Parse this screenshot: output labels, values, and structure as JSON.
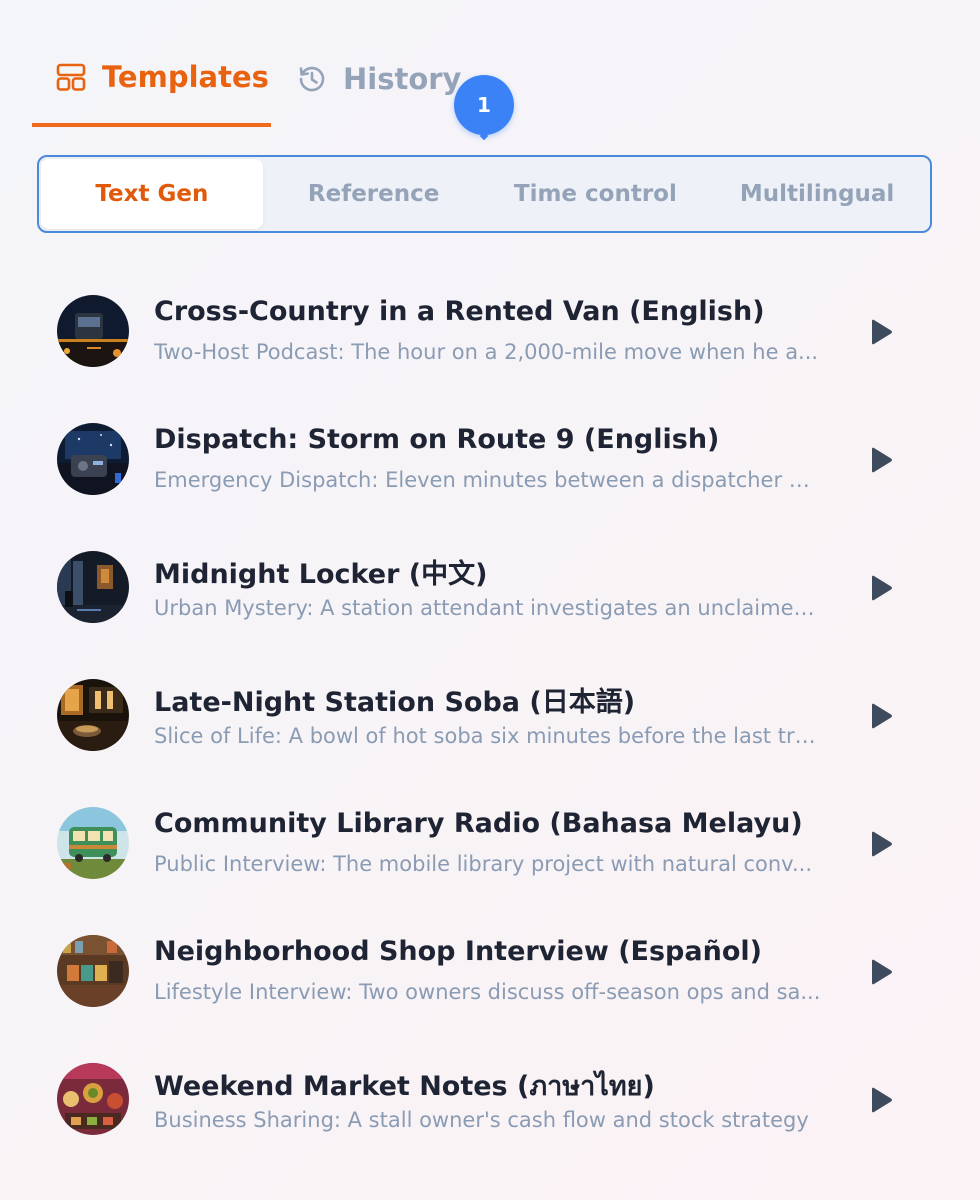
{
  "tabs": {
    "templates_label": "Templates",
    "history_label": "History",
    "accent_color": "#e8620f"
  },
  "badge": {
    "text": "1",
    "color": "#3b82f6"
  },
  "segments": [
    {
      "label": "Text Gen",
      "active": true
    },
    {
      "label": "Reference",
      "active": false
    },
    {
      "label": "Time control",
      "active": false
    },
    {
      "label": "Multilingual",
      "active": false
    }
  ],
  "items": [
    {
      "title": "Cross-Country in a Rented Van (English)",
      "subtitle": "Two-Host Podcast: The hour on a 2,000-mile move when he a...",
      "thumb_icon": "night-van-icon"
    },
    {
      "title": "Dispatch: Storm on Route 9 (English)",
      "subtitle": "Emergency Dispatch: Eleven minutes between a dispatcher an...",
      "thumb_icon": "radio-storm-icon"
    },
    {
      "title": "Midnight Locker (中文)",
      "subtitle": "Urban Mystery: A station attendant investigates an unclaimed...",
      "thumb_icon": "station-locker-icon"
    },
    {
      "title": "Late-Night Station Soba (日本語)",
      "subtitle": "Slice of Life: A bowl of hot soba six minutes before the last train",
      "thumb_icon": "soba-stall-icon"
    },
    {
      "title": "Community Library Radio (Bahasa Melayu)",
      "subtitle": "Public Interview: The mobile library project with natural conv...",
      "thumb_icon": "library-bus-icon"
    },
    {
      "title": "Neighborhood Shop Interview (Español)",
      "subtitle": "Lifestyle Interview: Two owners discuss off-season ops and sa...",
      "thumb_icon": "shop-shelves-icon"
    },
    {
      "title": "Weekend Market Notes (ภาษาไทย)",
      "subtitle": "Business Sharing: A stall owner's cash flow and stock strategy",
      "thumb_icon": "market-food-icon"
    }
  ]
}
